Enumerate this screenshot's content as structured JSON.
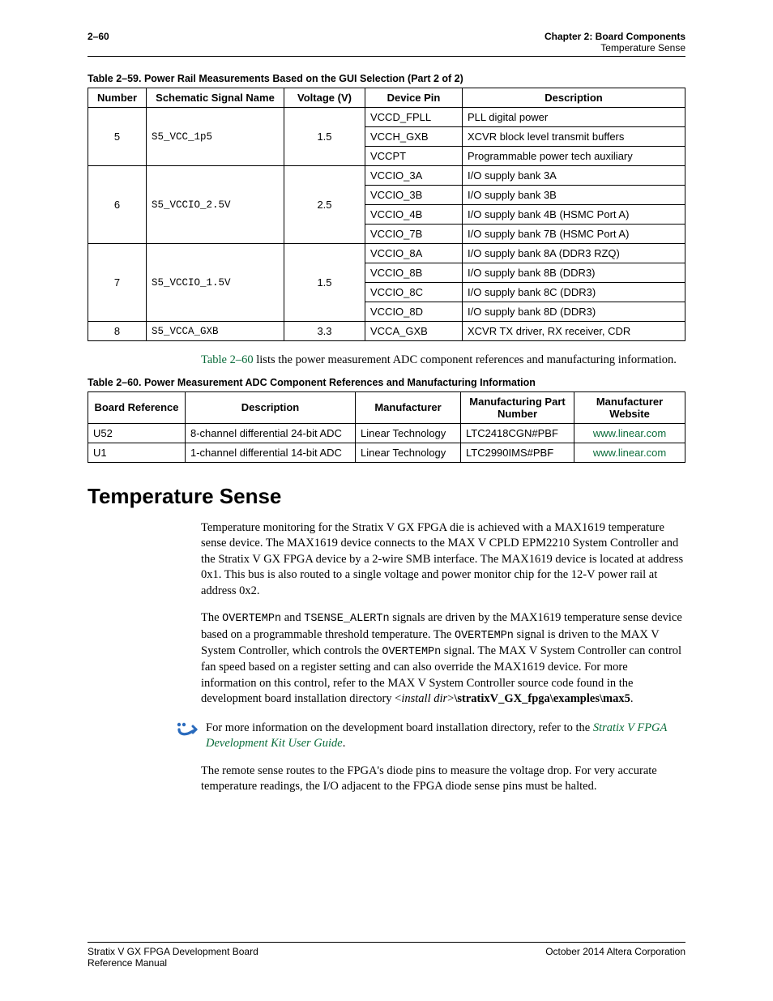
{
  "header": {
    "page_number": "2–60",
    "chapter": "Chapter 2: Board Components",
    "subhead": "Temperature Sense"
  },
  "table259": {
    "caption": "Table 2–59. Power Rail Measurements Based on the GUI Selection  (Part 2 of 2)",
    "head": {
      "number": "Number",
      "signal": "Schematic Signal Name",
      "voltage": "Voltage (V)",
      "pin": "Device Pin",
      "desc": "Description"
    },
    "r5": {
      "num": "5",
      "signal": "S5_VCC_1p5",
      "voltage": "1.5",
      "pin1": "VCCD_FPLL",
      "desc1": "PLL digital power",
      "pin2": "VCCH_GXB",
      "desc2": "XCVR block level transmit buffers",
      "pin3": "VCCPT",
      "desc3": "Programmable power tech auxiliary"
    },
    "r6": {
      "num": "6",
      "signal": "S5_VCCIO_2.5V",
      "voltage": "2.5",
      "pin1": "VCCIO_3A",
      "desc1": "I/O supply bank 3A",
      "pin2": "VCCIO_3B",
      "desc2": "I/O supply bank 3B",
      "pin3": "VCCIO_4B",
      "desc3": "I/O supply bank 4B (HSMC Port A)",
      "pin4": "VCCIO_7B",
      "desc4": "I/O supply bank 7B (HSMC Port A)"
    },
    "r7": {
      "num": "7",
      "signal": "S5_VCCIO_1.5V",
      "voltage": "1.5",
      "pin1": "VCCIO_8A",
      "desc1": "I/O supply bank 8A (DDR3 RZQ)",
      "pin2": "VCCIO_8B",
      "desc2": "I/O supply bank 8B (DDR3)",
      "pin3": "VCCIO_8C",
      "desc3": "I/O supply bank 8C (DDR3)",
      "pin4": "VCCIO_8D",
      "desc4": "I/O supply bank 8D (DDR3)"
    },
    "r8": {
      "num": "8",
      "signal": "S5_VCCA_GXB",
      "voltage": "3.3",
      "pin": "VCCA_GXB",
      "desc": "XCVR TX driver, RX receiver, CDR"
    }
  },
  "intro260_pre": "Table 2–60",
  "intro260_post": " lists the power measurement ADC component references and manufacturing information.",
  "table260": {
    "caption": "Table 2–60. Power Measurement ADC Component References and Manufacturing Information",
    "head": {
      "ref": "Board Reference",
      "desc": "Description",
      "manuf": "Manufacturer",
      "pn": "Manufacturing Part Number",
      "site": "Manufacturer Website"
    },
    "r1": {
      "ref": "U52",
      "desc": "8-channel differential 24-bit ADC",
      "manuf": "Linear Technology",
      "pn": "LTC2418CGN#PBF",
      "site": "www.linear.com"
    },
    "r2": {
      "ref": "U1",
      "desc": "1-channel differential 14-bit ADC",
      "manuf": "Linear Technology",
      "pn": "LTC2990IMS#PBF",
      "site": "www.linear.com"
    }
  },
  "section_title": "Temperature Sense",
  "para1": "Temperature monitoring for the Stratix V GX FPGA die is achieved with a MAX1619 temperature sense device. The MAX1619 device connects to the MAX V CPLD EPM2210 System Controller and the Stratix V GX FPGA device by a 2-wire SMB interface. The MAX1619 device is located at address 0x1. This bus is also routed to a single voltage and power monitor chip for the 12-V power rail at address 0x2.",
  "para2": {
    "a": "The ",
    "m1": "OVERTEMPn",
    "b": " and ",
    "m2": "TSENSE_ALERTn",
    "c": " signals are driven by the MAX1619 temperature sense device based on a programmable threshold temperature. The ",
    "m3": "OVERTEMPn",
    "d": " signal is driven to the MAX V System Controller, which controls the ",
    "m4": "OVERTEMPn",
    "e": " signal. The MAX V System Controller can control fan speed based on a register setting and can also override the MAX1619 device. For more information on this control, refer to the MAX V System Controller source code found in the development board installation directory <",
    "i1": "install dir",
    "f": ">",
    "s1": "\\stratixV_GX_fpga\\examples\\max5",
    "g": "."
  },
  "note": {
    "a": "For more information on the development board installation directory, refer to the ",
    "link": "Stratix V FPGA Development Kit User Guide",
    "b": "."
  },
  "para3": "The remote sense routes to the FPGA's diode pins to measure the voltage drop. For very accurate temperature readings, the I/O adjacent to the FPGA diode sense pins must be halted.",
  "footer": {
    "left1": "Stratix V GX FPGA Development Board",
    "left2": "Reference Manual",
    "right": "October 2014   Altera Corporation"
  }
}
